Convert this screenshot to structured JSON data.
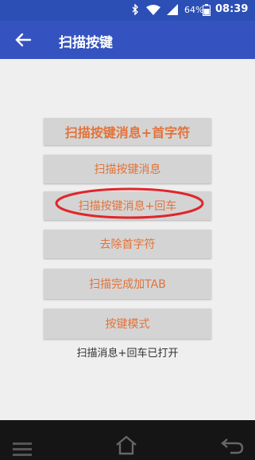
{
  "status_bar": {
    "battery": "64%",
    "time": "08:39",
    "icons": [
      "bluetooth-icon",
      "wifi-icon",
      "signal-icon",
      "battery-icon"
    ]
  },
  "app_bar": {
    "title": "扫描按键",
    "back_icon": "back-arrow-icon"
  },
  "buttons": [
    {
      "label": "扫描按键消息+首字符"
    },
    {
      "label": "扫描按键消息"
    },
    {
      "label": "扫描按键消息+回车"
    },
    {
      "label": "去除首字符"
    },
    {
      "label": "扫描完成加TAB"
    },
    {
      "label": "按键模式"
    }
  ],
  "status_text": "扫描消息+回车已打开",
  "colors": {
    "app_bar": "#3553c0",
    "button_text": "#e2733a",
    "button_bg": "#d4d4d4",
    "highlight_ellipse": "#e0262b"
  },
  "nav_bar": {
    "icons": [
      "menu-icon",
      "home-icon",
      "back-icon"
    ]
  }
}
